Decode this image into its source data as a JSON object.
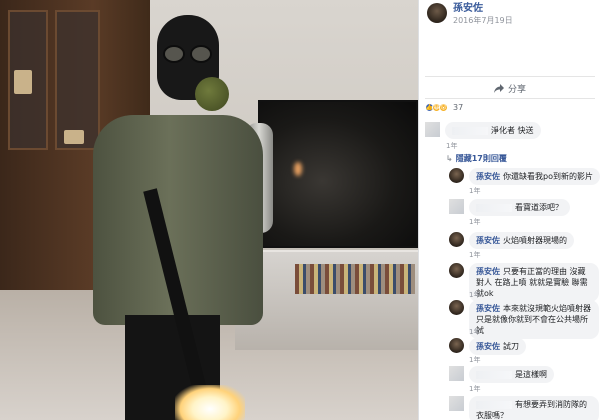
{
  "post": {
    "author": "孫安佐",
    "date": "2016年7月19日",
    "share_label": "分享",
    "reaction_count": "37",
    "reactions": [
      "like",
      "haha",
      "wow"
    ]
  },
  "comments": [
    {
      "id": "c1",
      "author": "",
      "text": "淨化者 快送",
      "time": "1年",
      "replies_label": "隱藏17則回覆"
    }
  ],
  "replies": [
    {
      "author": "孫安佐",
      "text": "你還缺看我po到新的影片",
      "time": "1年"
    },
    {
      "author": "",
      "text": "看寶道添吧？",
      "time": "1年"
    },
    {
      "author": "孫安佐",
      "text": "火焰噴射器現場的",
      "time": "1年"
    },
    {
      "author": "孫安佐",
      "text": "只要有正當的理由 沒藏對人 在路上噴 就就是實驗 聯需就ok",
      "time": "1年"
    },
    {
      "author": "孫安佐",
      "text": "本來就沒規範火焰噴射器 只是就像你就到不會在公共場所試",
      "time": "1年"
    },
    {
      "author": "孫安佐",
      "text": "試刀",
      "time": "1年"
    },
    {
      "author": "",
      "text": "是這樣啊",
      "time": "1年"
    },
    {
      "author": "",
      "text": "有想要弄到消防隊的衣服嗎？",
      "time": ""
    }
  ]
}
